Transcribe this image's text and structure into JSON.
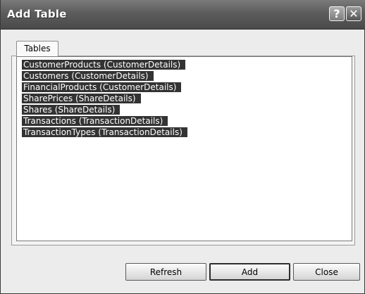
{
  "window": {
    "title": "Add Table",
    "help_glyph": "?",
    "close_glyph": "✕"
  },
  "tabs": [
    {
      "label": "Tables",
      "selected": true
    }
  ],
  "tables": [
    "CustomerProducts (CustomerDetails)",
    "Customers (CustomerDetails)",
    "FinancialProducts (CustomerDetails)",
    "SharePrices (ShareDetails)",
    "Shares (ShareDetails)",
    "Transactions (TransactionDetails)",
    "TransactionTypes (TransactionDetails)"
  ],
  "buttons": {
    "refresh": "Refresh",
    "add": "Add",
    "close": "Close"
  },
  "colors": {
    "selection_bg": "#333333",
    "selection_fg": "#ffffff",
    "titlebar": "#5c5c5c"
  }
}
